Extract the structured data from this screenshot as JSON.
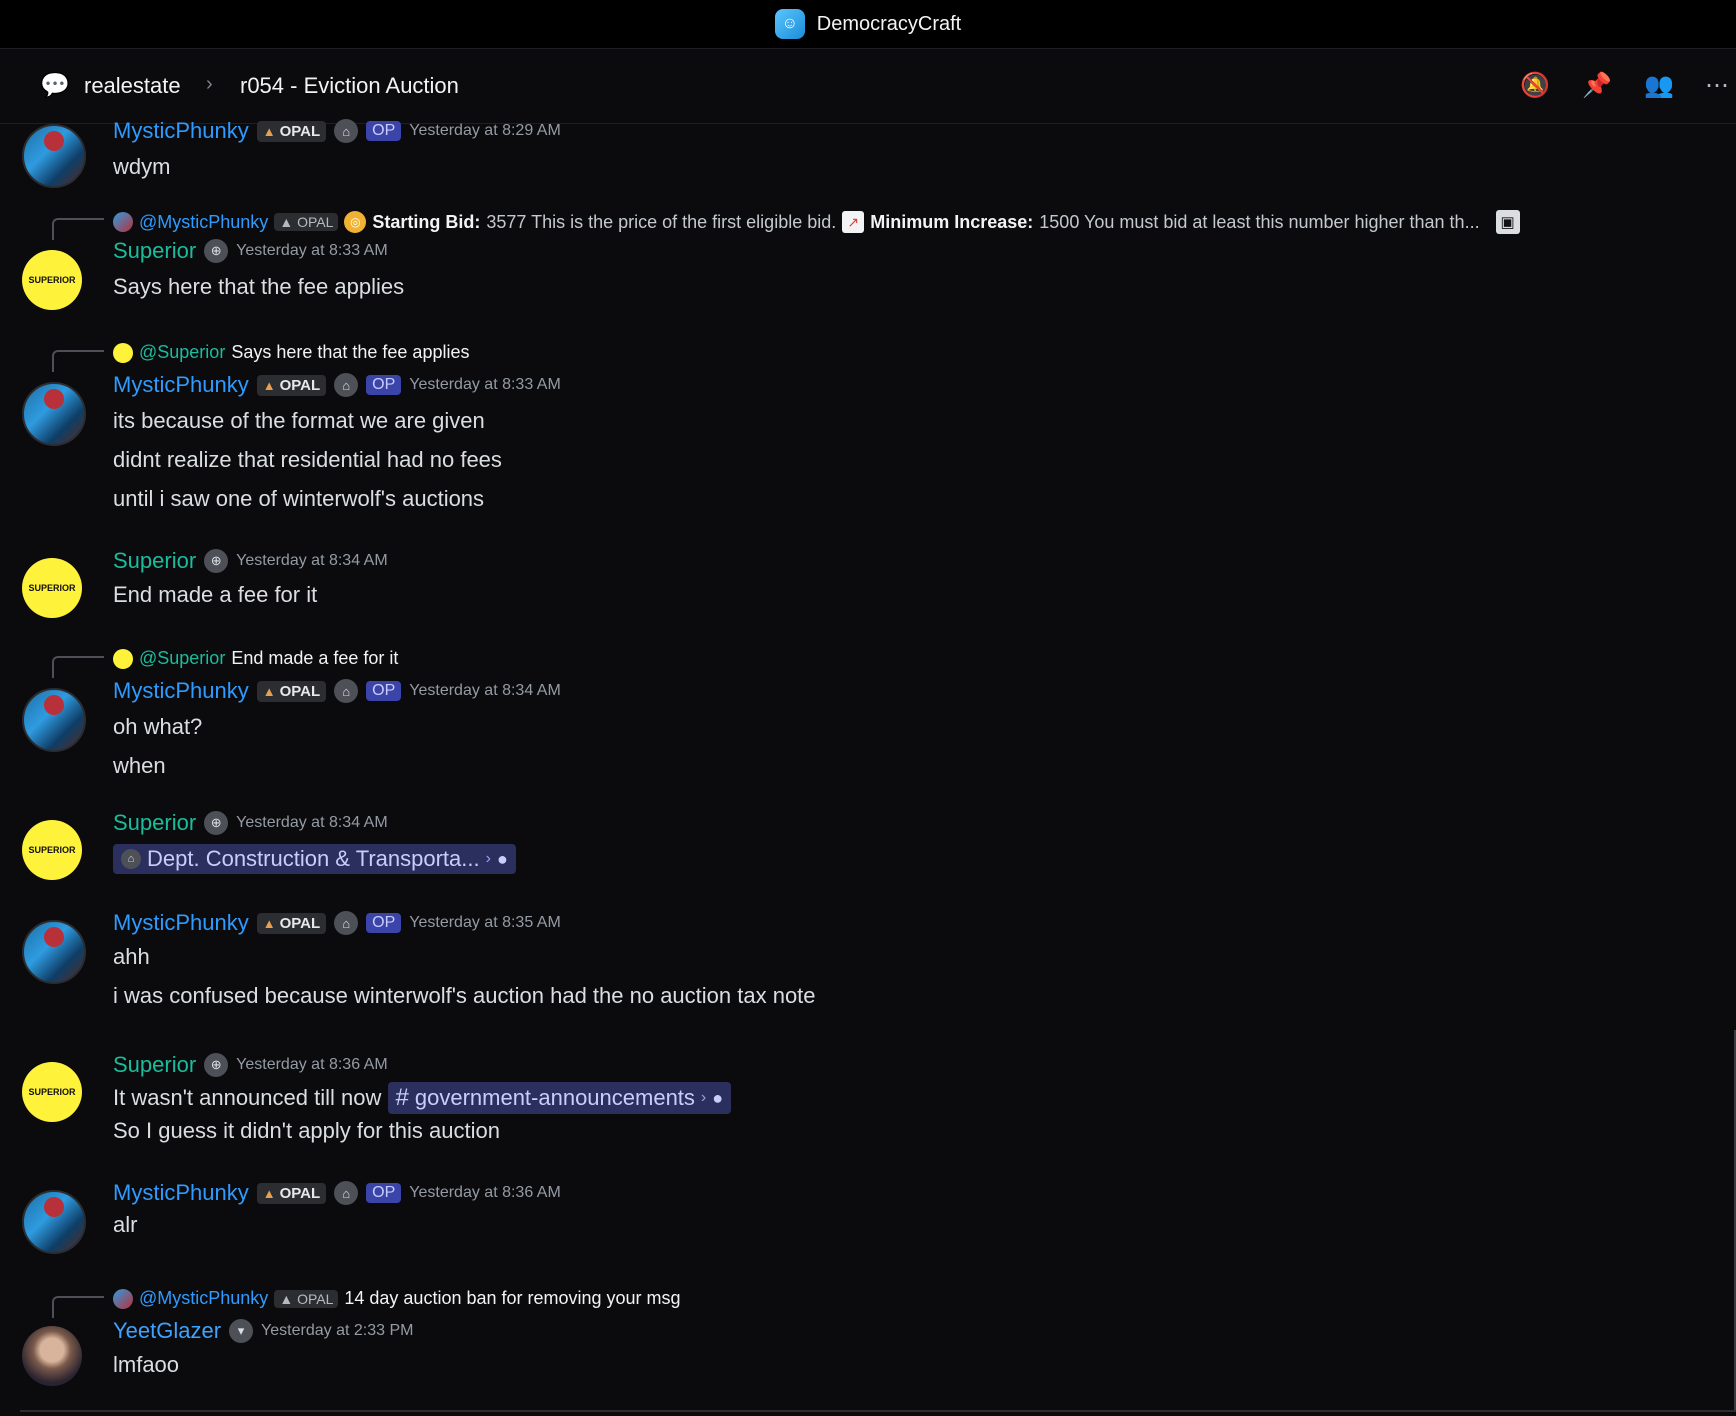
{
  "window": {
    "title": "DemocracyCraft"
  },
  "header": {
    "forum": "realestate",
    "separator": "›",
    "thread": "r054 - Eviction Auction",
    "icons": [
      "notifications-off-icon",
      "pin-icon",
      "members-icon",
      "more-icon"
    ]
  },
  "badges": {
    "opal": "OPAL",
    "op": "OP"
  },
  "messages": [
    {
      "author": "MysticPhunky",
      "time": "Yesterday at 8:29 AM",
      "lines": [
        "wdym"
      ]
    },
    {
      "author": "Superior",
      "time": "Yesterday at 8:33 AM",
      "reply": {
        "name": "@MysticPhunky",
        "bid_label": "Starting Bid:",
        "bid_text": "3577 This is the price of the first eligible bid.",
        "inc_label": "Minimum Increase:",
        "inc_text": "1500 You must bid at least this number higher than th..."
      },
      "lines": [
        "Says here that the fee applies"
      ]
    },
    {
      "author": "MysticPhunky",
      "time": "Yesterday at 8:33 AM",
      "reply": {
        "name": "@Superior",
        "text": "Says here that the fee applies"
      },
      "lines": [
        "its because of the format we are given",
        "didnt realize that residential had no fees",
        "until i saw one of winterwolf's auctions"
      ]
    },
    {
      "author": "Superior",
      "time": "Yesterday at 8:34 AM",
      "lines": [
        "End made a fee for it"
      ]
    },
    {
      "author": "MysticPhunky",
      "time": "Yesterday at 8:34 AM",
      "reply": {
        "name": "@Superior",
        "text": "End made a fee for it"
      },
      "lines": [
        "oh what?",
        "when"
      ]
    },
    {
      "author": "Superior",
      "time": "Yesterday at 8:34 AM",
      "channel_link": "Dept. Construction & Transporta..."
    },
    {
      "author": "MysticPhunky",
      "time": "Yesterday at 8:35 AM",
      "lines": [
        "ahh",
        "i was confused because winterwolf's auction had the no auction tax note"
      ]
    },
    {
      "author": "Superior",
      "time": "Yesterday at 8:36 AM",
      "lines": [
        "It wasn't announced till now",
        "So I guess it didn't apply for this auction"
      ],
      "channel_link": "government-announcements"
    },
    {
      "author": "MysticPhunky",
      "time": "Yesterday at 8:36 AM",
      "lines": [
        "alr"
      ]
    },
    {
      "author": "YeetGlazer",
      "time": "Yesterday at 2:33 PM",
      "reply": {
        "name": "@MysticPhunky",
        "text": "14 day auction ban for removing your msg"
      },
      "lines": [
        "lmfaoo"
      ]
    }
  ]
}
